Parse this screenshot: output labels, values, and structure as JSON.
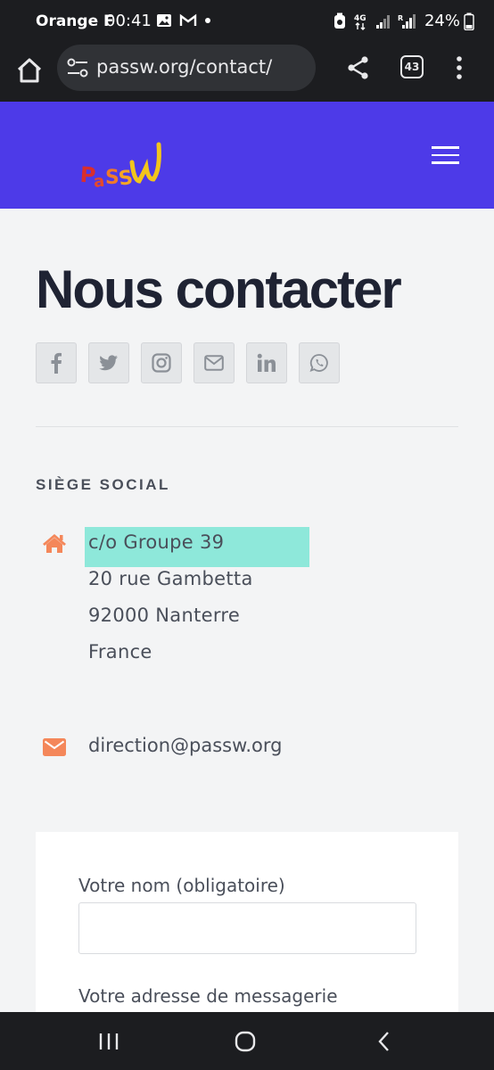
{
  "status_bar": {
    "carrier": "Orange F",
    "time": "00:41",
    "network": "4G",
    "battery": "24%"
  },
  "browser": {
    "url": "passw.org/contact/",
    "tab_count": "43"
  },
  "site": {
    "logo_text": "PaSSW"
  },
  "page": {
    "title": "Nous contacter",
    "social": [
      "facebook",
      "twitter",
      "instagram",
      "email",
      "linkedin",
      "whatsapp"
    ],
    "section_label": "SIÈGE SOCIAL",
    "address": [
      "c/o Groupe 39",
      "20 rue Gambetta",
      "92000 Nanterre",
      "France"
    ],
    "email": "direction@passw.org"
  },
  "form": {
    "name_label": "Votre nom (obligatoire)",
    "email_label": "Votre adresse de messagerie"
  },
  "colors": {
    "header_bg": "#4d3ae8",
    "accent_orange": "#f4875a",
    "highlight": "#8ee8da"
  }
}
